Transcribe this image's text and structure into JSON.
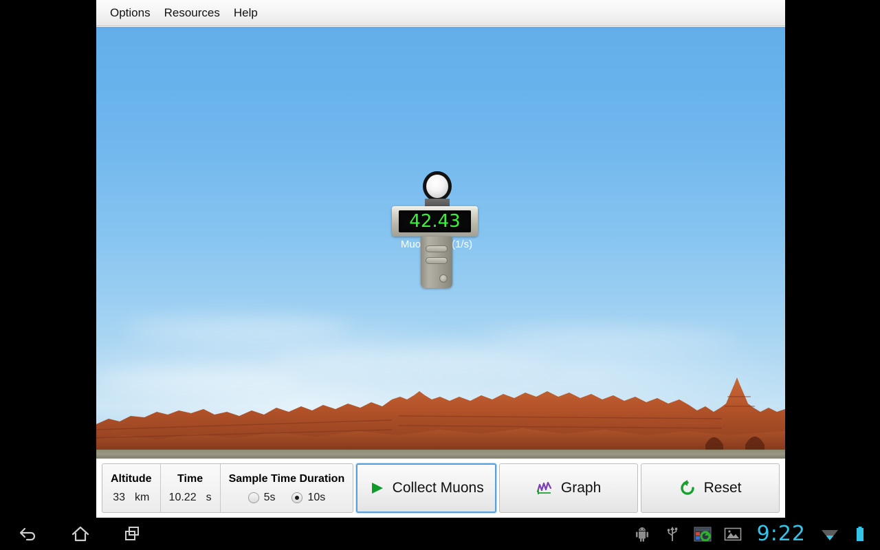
{
  "menu": {
    "items": [
      {
        "label": "Options",
        "name": "menu-item-options"
      },
      {
        "label": "Resources",
        "name": "menu-item-resources"
      },
      {
        "label": "Help",
        "name": "menu-item-help"
      }
    ]
  },
  "detector": {
    "flux_value": "42.43",
    "flux_label": "Muon Flux  (1/s)",
    "led_color": "#3cf03c",
    "led_background": "#080808"
  },
  "readouts": {
    "altitude": {
      "title": "Altitude",
      "value": "33",
      "unit": "km"
    },
    "time": {
      "title": "Time",
      "value": "10.22",
      "unit": "s"
    },
    "sample_duration": {
      "title": "Sample Time Duration",
      "options": [
        {
          "label": "5s",
          "selected": false
        },
        {
          "label": "10s",
          "selected": true
        }
      ]
    }
  },
  "buttons": [
    {
      "label": "Collect Muons",
      "icon": "play-triangle-icon",
      "focused": true,
      "accent": "#0e9c28"
    },
    {
      "label": "Graph",
      "icon": "line-chart-icon",
      "focused": false,
      "accent": "#7a3fb0"
    },
    {
      "label": "Reset",
      "icon": "refresh-circular-arrow-icon",
      "focused": false,
      "accent": "#18a02c"
    }
  ],
  "system_bar": {
    "nav": [
      {
        "name": "back-icon"
      },
      {
        "name": "home-icon"
      },
      {
        "name": "recents-icon"
      }
    ],
    "status": [
      {
        "name": "android-robot-icon"
      },
      {
        "name": "usb-icon"
      },
      {
        "name": "screenshot-app-icon"
      },
      {
        "name": "image-icon"
      }
    ],
    "clock": "9:22",
    "trailing": [
      {
        "name": "wifi-icon"
      },
      {
        "name": "battery-icon"
      }
    ],
    "accent": "#33c4e8"
  },
  "scene": {
    "sky_top": "#63aeea",
    "sky_horizon": "#c6e3f4",
    "rock_color": "#b5542a",
    "ground_color": "#9a9784"
  }
}
